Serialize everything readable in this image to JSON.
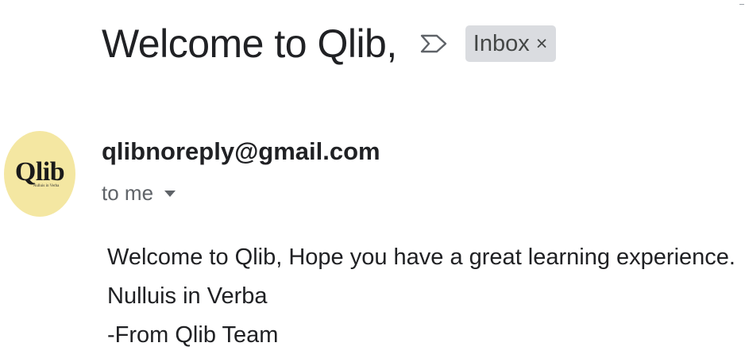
{
  "email": {
    "subject": "Welcome to Qlib,",
    "label": "Inbox",
    "label_remove": "×",
    "sender": "qlibnoreply@gmail.com",
    "recipient": "to me",
    "body_lines": [
      "Welcome to Qlib, Hope you have a great learning experience.",
      "Nulluis in Verba",
      "-From Qlib Team"
    ]
  },
  "avatar": {
    "title": "Qlib",
    "motto": "Nulluis in Verba",
    "background": "#f4e7a2"
  },
  "icons": {
    "importance": "importance-marker-icon",
    "recipient_details": "caret-down-icon"
  },
  "colors": {
    "text": "#202124",
    "muted": "#5f6368",
    "chip": "#dadce0"
  }
}
